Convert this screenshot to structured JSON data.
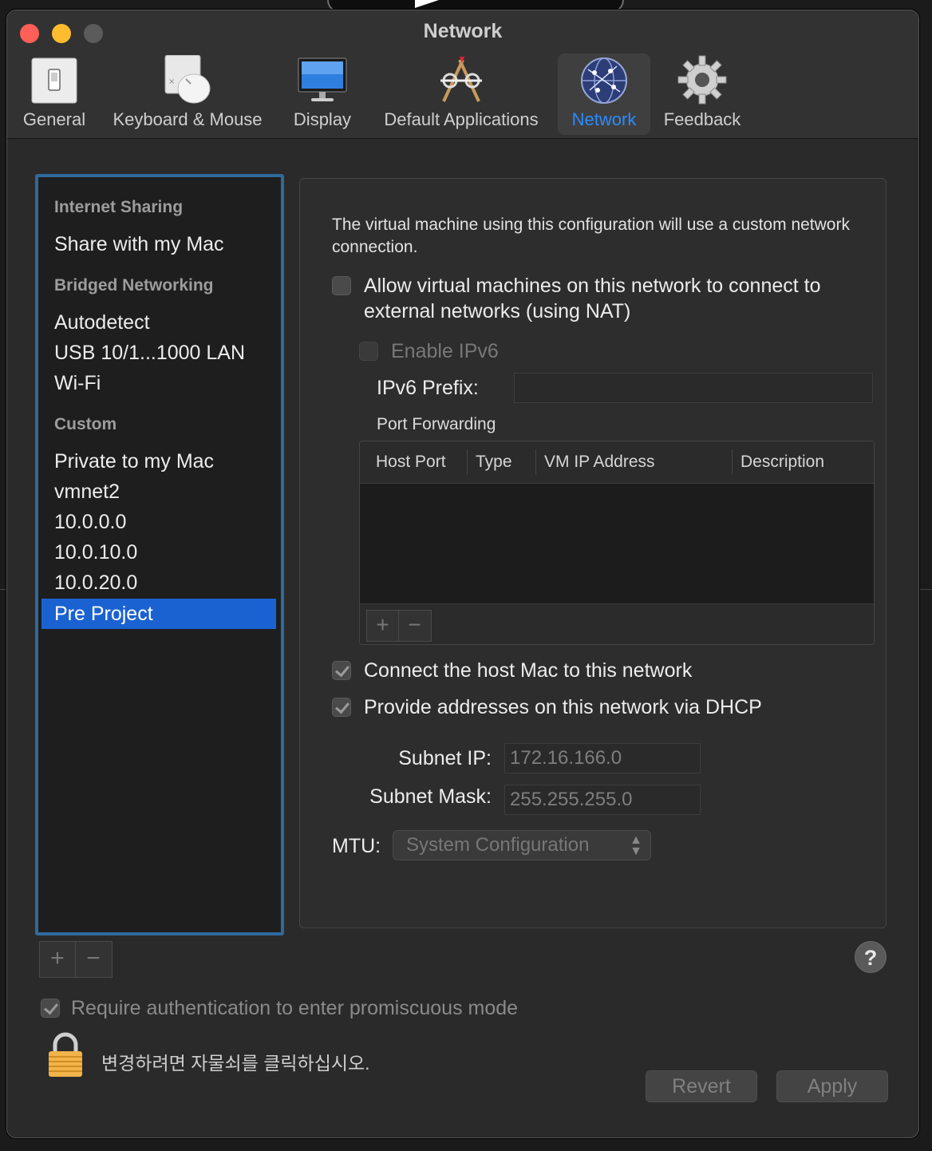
{
  "window": {
    "title": "Network"
  },
  "toolbar": {
    "items": [
      {
        "label": "General",
        "icon": "general-switch-icon"
      },
      {
        "label": "Keyboard & Mouse",
        "icon": "keyboard-mouse-icon"
      },
      {
        "label": "Display",
        "icon": "display-monitor-icon"
      },
      {
        "label": "Default Applications",
        "icon": "default-applications-icon"
      },
      {
        "label": "Network",
        "icon": "network-globe-icon",
        "selected": true
      },
      {
        "label": "Feedback",
        "icon": "gear-icon"
      }
    ],
    "selected_color": "#2a8cff"
  },
  "sidebar": {
    "sections": [
      {
        "header": "Internet Sharing",
        "items": [
          "Share with my Mac"
        ]
      },
      {
        "header": "Bridged Networking",
        "items": [
          "Autodetect",
          "USB 10/1...1000 LAN",
          "Wi-Fi"
        ]
      },
      {
        "header": "Custom",
        "items": [
          "Private to my Mac",
          "vmnet2",
          "10.0.0.0",
          "10.0.10.0",
          "10.0.20.0",
          "Pre Project"
        ]
      }
    ],
    "selected_item": "Pre Project",
    "selection_color": "#1a62d2",
    "add_symbol": "+",
    "remove_symbol": "−"
  },
  "panel": {
    "description": "The virtual machine using this configuration will use a custom network connection.",
    "nat_checkbox": {
      "label": "Allow virtual machines on this network to connect to external networks (using NAT)",
      "checked": false
    },
    "ipv6_checkbox": {
      "label": "Enable IPv6",
      "checked": false,
      "enabled": false
    },
    "ipv6_prefix": {
      "label": "IPv6 Prefix:",
      "value": ""
    },
    "port_forwarding": {
      "title": "Port Forwarding",
      "columns": [
        "Host Port",
        "Type",
        "VM IP Address",
        "Description"
      ],
      "rows": [],
      "add_symbol": "+",
      "remove_symbol": "−"
    },
    "connect_host_checkbox": {
      "label": "Connect the host Mac to this network",
      "checked": true
    },
    "dhcp_checkbox": {
      "label": "Provide addresses on this network via DHCP",
      "checked": true
    },
    "subnet_ip": {
      "label": "Subnet IP:",
      "value": "172.16.166.0"
    },
    "subnet_mask": {
      "label": "Subnet Mask:",
      "value": "255.255.255.0"
    },
    "mtu": {
      "label": "MTU:",
      "value": "System Configuration"
    }
  },
  "footer": {
    "help_symbol": "?",
    "promiscuous_checkbox": {
      "label": "Require authentication to enter promiscuous mode",
      "checked": true
    },
    "lock_text": "변경하려면 자물쇠를 클릭하십시오.",
    "revert_label": "Revert",
    "apply_label": "Apply"
  }
}
